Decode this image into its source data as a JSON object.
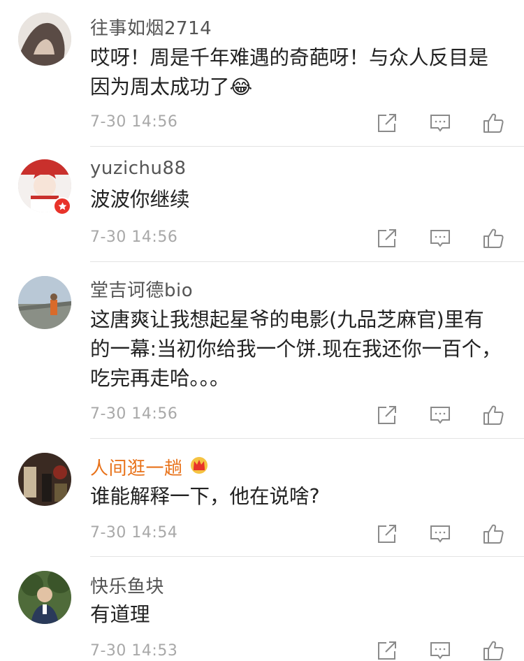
{
  "comments": [
    {
      "username": "往事如烟2714",
      "text": "哎呀！周是千年难遇的奇葩呀！与众人反目是因为周太成功了",
      "emoji": "😂",
      "time": "7-30 14:56"
    },
    {
      "username": "yuzichu88",
      "text": "波波你继续",
      "time": "7-30 14:56"
    },
    {
      "username": "堂吉诃德bio",
      "text": "这唐爽让我想起星爷的电影(九品芝麻官)里有的一幕:当初你给我一个饼.现在我还你一百个，吃完再走哈。。。",
      "time": "7-30 14:56"
    },
    {
      "username": "人间逛一趟",
      "text": "谁能解释一下，他在说啥?",
      "time": "7-30 14:54"
    },
    {
      "username": "快乐鱼块",
      "text": "有道理",
      "time": "7-30 14:53"
    }
  ],
  "icons": {
    "share": "share-icon",
    "reply": "comment-icon",
    "like": "thumbs-up-icon"
  },
  "colors": {
    "vip_name": "#e8721a",
    "timestamp": "#a8a8a8",
    "text": "#222222",
    "username": "#555555",
    "badge": "#e8332a"
  }
}
